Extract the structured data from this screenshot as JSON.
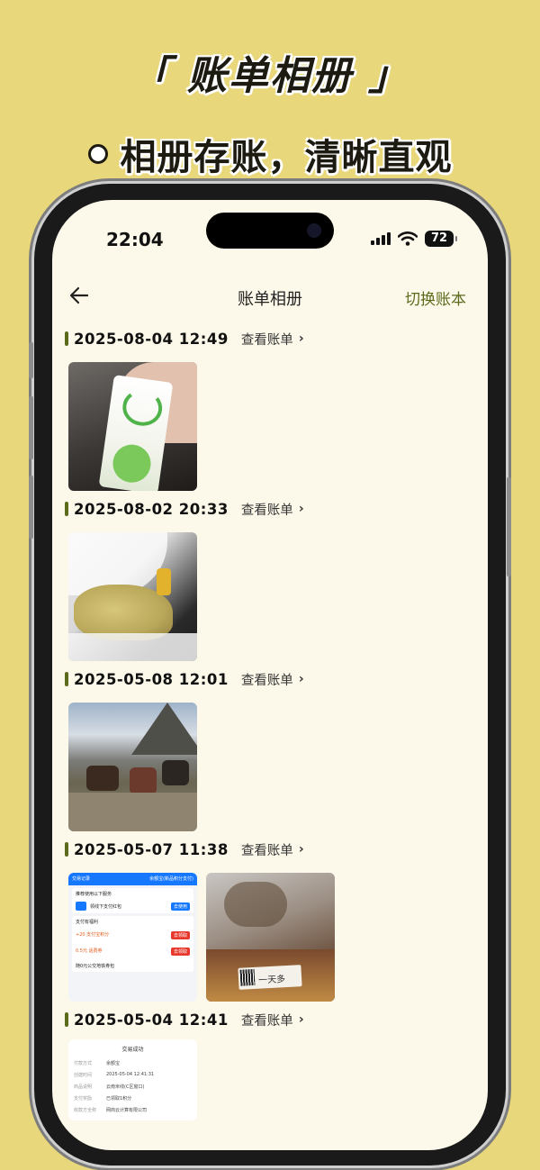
{
  "promo": {
    "title": "「 账单相册 」",
    "subtitle": "相册存账，清晰直观"
  },
  "status_bar": {
    "time": "22:04",
    "battery": "72"
  },
  "nav": {
    "title": "账单相册",
    "right_action": "切换账本"
  },
  "groups": [
    {
      "datetime": "2025-08-04 12:49",
      "link": "查看账单"
    },
    {
      "datetime": "2025-08-02 20:33",
      "link": "查看账单"
    },
    {
      "datetime": "2025-05-08 12:01",
      "link": "查看账单"
    },
    {
      "datetime": "2025-05-07 11:38",
      "link": "查看账单"
    },
    {
      "datetime": "2025-05-04 12:41",
      "link": "查看账单"
    }
  ],
  "receipt_photo": {
    "header_left": "交易记录",
    "header_right": "余额宝(新品积分支付)",
    "promo_title": "推荐使用以下服务",
    "promo_item": "领线下支付红包",
    "promo_button": "去使用",
    "points_title": "支付有福利",
    "row1": "+20 支付宝积分",
    "row1_btn": "去领取",
    "row2": "0.5元 话费券",
    "row2_btn": "去领取",
    "row3": "随0元公交地铁券包"
  },
  "bag_photo": {
    "label": "一天多"
  },
  "receipt2_photo": {
    "status": "交易成功",
    "rows": [
      {
        "k": "付款方式",
        "v": "余额宝"
      },
      {
        "k": "创建时间",
        "v": "2025-05-04 12:41:31"
      },
      {
        "k": "商品说明",
        "v": "云南米线(C区窗口)"
      },
      {
        "k": "支付奖励",
        "v": "已领取1积分"
      },
      {
        "k": "收款方全称",
        "v": "网商云计算有限公司"
      }
    ]
  },
  "colors": {
    "background": "#e9d77c",
    "screen": "#fdf9ea",
    "accent": "#5c6a1c"
  }
}
